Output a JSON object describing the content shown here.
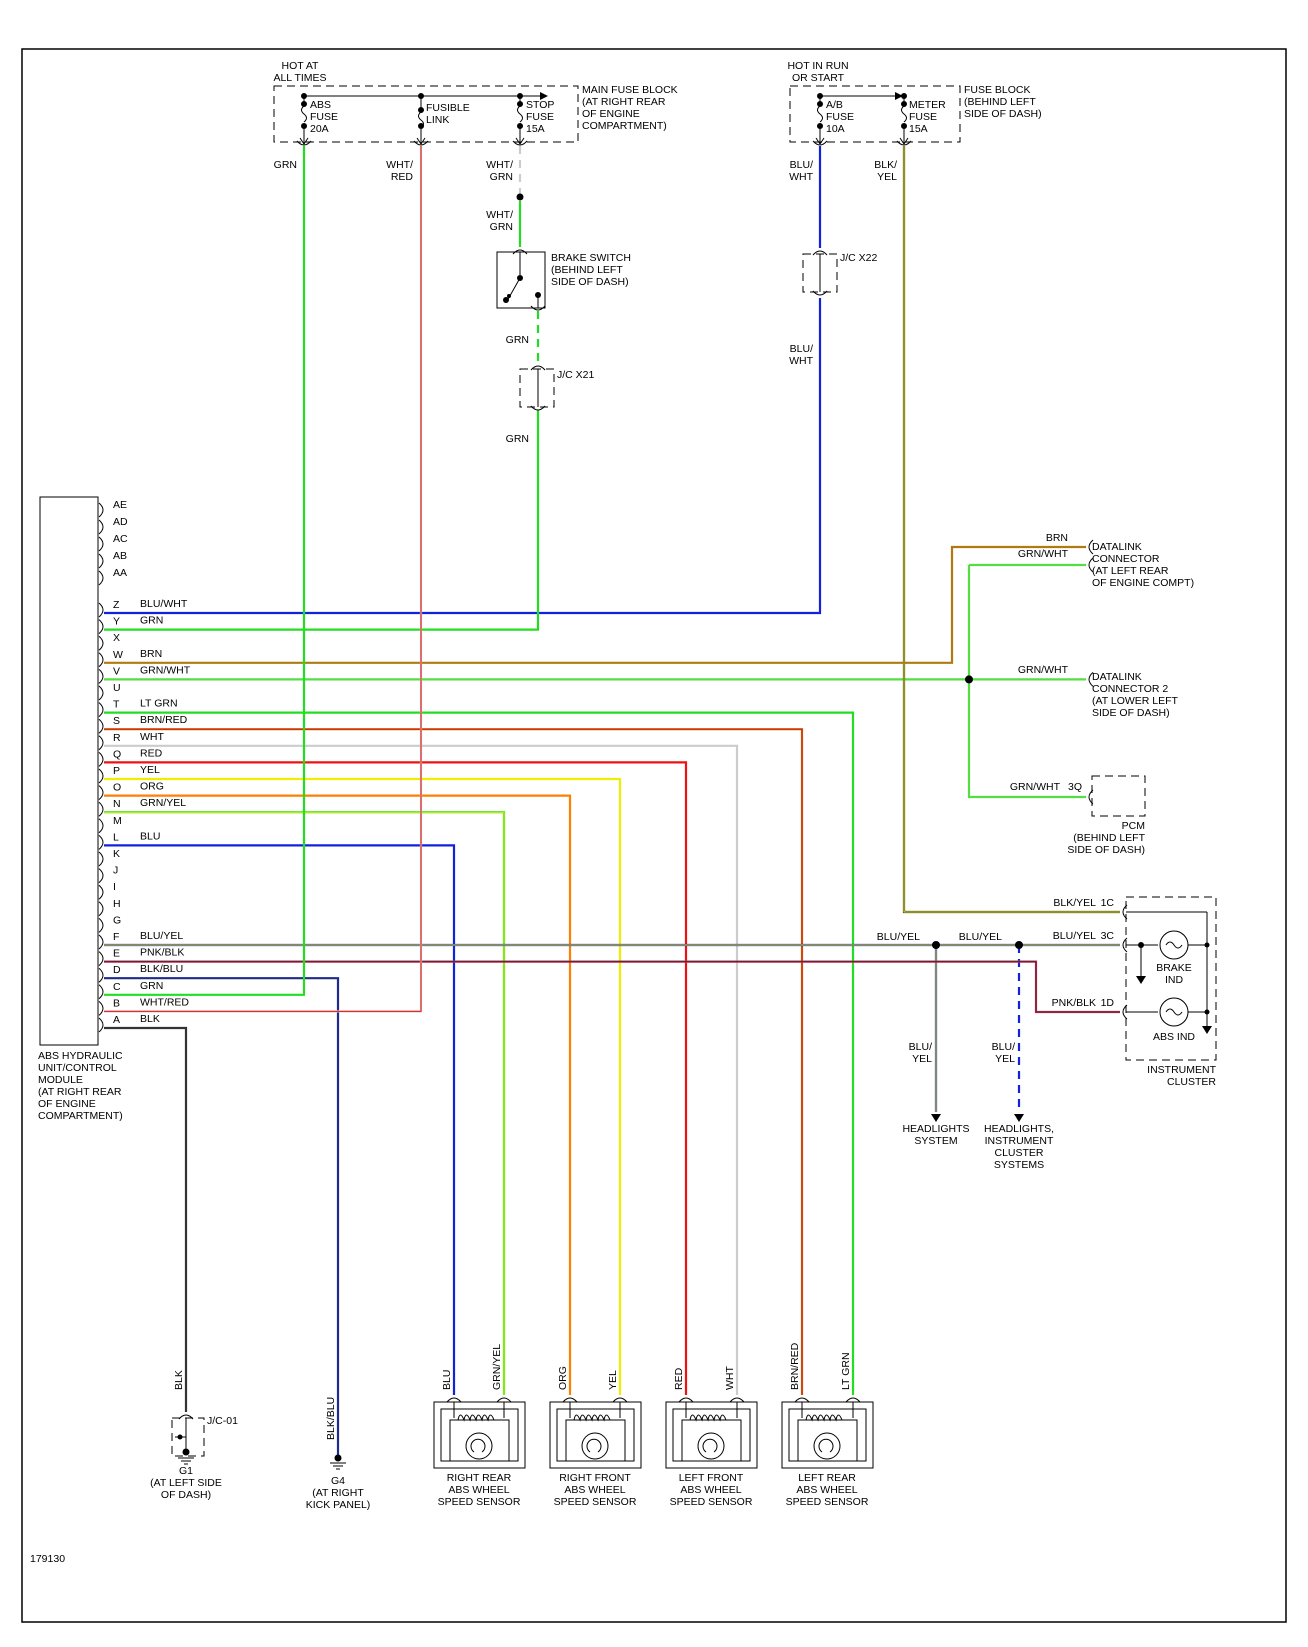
{
  "diagram_id": "179130",
  "colors": {
    "GRN": "#22dd22",
    "LTGRN": "#22dd22",
    "RED": "#ee1111",
    "WHT": "#cccccc",
    "BLU": "#1122dd",
    "YEL": "#eeee00",
    "BRN": "#b07a10",
    "ORG": "#ff7f00",
    "BLK": "#333333",
    "PNK": "#dd2255",
    "GRNWHT": "#55dd44"
  },
  "power": {
    "main_hot_label": [
      "HOT AT",
      "ALL TIMES"
    ],
    "run_hot_label": [
      "HOT IN RUN",
      "OR START"
    ],
    "main_fuse_block": [
      "MAIN FUSE BLOCK",
      "(AT RIGHT REAR",
      "OF ENGINE",
      "COMPARTMENT)"
    ],
    "fuse_block": [
      "FUSE BLOCK",
      "(BEHIND LEFT",
      "SIDE OF DASH)"
    ],
    "fuses": [
      {
        "name": [
          "ABS",
          "FUSE",
          "20A"
        ],
        "wire": [
          "GRN"
        ]
      },
      {
        "name": [
          "FUSIBLE",
          "LINK"
        ],
        "wire": [
          "WHT/",
          "RED"
        ]
      },
      {
        "name": [
          "STOP",
          "FUSE",
          "15A"
        ],
        "wire": [
          "WHT/",
          "GRN"
        ]
      },
      {
        "name": [
          "A/B",
          "FUSE",
          "10A"
        ],
        "wire": [
          "BLU/",
          "WHT"
        ]
      },
      {
        "name": [
          "METER",
          "FUSE",
          "15A"
        ],
        "wire": [
          "BLK/",
          "YEL"
        ]
      }
    ]
  },
  "brake_switch": {
    "label": [
      "BRAKE SWITCH",
      "(BEHIND LEFT",
      "SIDE OF DASH)"
    ],
    "wire_in": [
      "WHT/",
      "GRN"
    ],
    "wire_out": "GRN",
    "jc": "J/C X21",
    "wire_after_jc": "GRN"
  },
  "jc_x22": {
    "label": "J/C X22",
    "wire_after": [
      "BLU/",
      "WHT"
    ]
  },
  "module": {
    "label": [
      "ABS HYDRAULIC",
      "UNIT/CONTROL",
      "MODULE",
      "(AT RIGHT REAR",
      "OF ENGINE",
      "COMPARTMENT)"
    ],
    "pins": [
      {
        "pin": "AE",
        "wire": ""
      },
      {
        "pin": "AD",
        "wire": ""
      },
      {
        "pin": "AC",
        "wire": ""
      },
      {
        "pin": "AB",
        "wire": ""
      },
      {
        "pin": "AA",
        "wire": ""
      },
      {
        "pin": "Z",
        "wire": "BLU/WHT"
      },
      {
        "pin": "Y",
        "wire": "GRN"
      },
      {
        "pin": "X",
        "wire": ""
      },
      {
        "pin": "W",
        "wire": "BRN"
      },
      {
        "pin": "V",
        "wire": "GRN/WHT"
      },
      {
        "pin": "U",
        "wire": ""
      },
      {
        "pin": "T",
        "wire": "LT GRN"
      },
      {
        "pin": "S",
        "wire": "BRN/RED"
      },
      {
        "pin": "R",
        "wire": "WHT"
      },
      {
        "pin": "Q",
        "wire": "RED"
      },
      {
        "pin": "P",
        "wire": "YEL"
      },
      {
        "pin": "O",
        "wire": "ORG"
      },
      {
        "pin": "N",
        "wire": "GRN/YEL"
      },
      {
        "pin": "M",
        "wire": ""
      },
      {
        "pin": "L",
        "wire": "BLU"
      },
      {
        "pin": "K",
        "wire": ""
      },
      {
        "pin": "J",
        "wire": ""
      },
      {
        "pin": "I",
        "wire": ""
      },
      {
        "pin": "H",
        "wire": ""
      },
      {
        "pin": "G",
        "wire": ""
      },
      {
        "pin": "F",
        "wire": "BLU/YEL"
      },
      {
        "pin": "E",
        "wire": "PNK/BLK"
      },
      {
        "pin": "D",
        "wire": "BLK/BLU"
      },
      {
        "pin": "C",
        "wire": "GRN"
      },
      {
        "pin": "B",
        "wire": "WHT/RED"
      },
      {
        "pin": "A",
        "wire": "BLK"
      }
    ]
  },
  "datalink1": {
    "wires": [
      "BRN",
      "GRN/WHT"
    ],
    "label": [
      "DATALINK",
      "CONNECTOR",
      "(AT LEFT REAR",
      "OF ENGINE COMPT)"
    ]
  },
  "datalink2": {
    "wire": "GRN/WHT",
    "label": [
      "DATALINK",
      "CONNECTOR 2",
      "(AT LOWER LEFT",
      "SIDE OF DASH)"
    ]
  },
  "pcm": {
    "wire": "GRN/WHT",
    "pin": "3Q",
    "label": [
      "PCM",
      "(BEHIND LEFT",
      "SIDE OF DASH)"
    ]
  },
  "cluster": {
    "label": [
      "INSTRUMENT",
      "CLUSTER"
    ],
    "pins": [
      {
        "wire": "BLK/YEL",
        "pin": "1C"
      },
      {
        "wire": "BLU/YEL",
        "pin": "3C"
      },
      {
        "wire": "PNK/BLK",
        "pin": "1D"
      }
    ],
    "brake_ind": [
      "BRAKE",
      "IND"
    ],
    "abs_ind": "ABS IND",
    "splice_labels": [
      "BLU/YEL",
      "BLU/YEL"
    ]
  },
  "outputs": [
    {
      "wire": [
        "BLU/",
        "YEL"
      ],
      "label": [
        "HEADLIGHTS",
        "SYSTEM"
      ]
    },
    {
      "wire": [
        "BLU/",
        "YEL"
      ],
      "label": [
        "HEADLIGHTS,",
        "INSTRUMENT",
        "CLUSTER",
        "SYSTEMS"
      ]
    }
  ],
  "grounds": [
    {
      "wire": "BLK",
      "jc": "J/C-01",
      "name": "G1",
      "label": [
        "(AT LEFT SIDE",
        "OF DASH)"
      ]
    },
    {
      "wire": "BLK/BLU",
      "name": "G4",
      "label": [
        "(AT RIGHT",
        "KICK PANEL)"
      ]
    }
  ],
  "sensors": [
    {
      "wires": [
        "BLU",
        "GRN/YEL"
      ],
      "label": [
        "RIGHT REAR",
        "ABS WHEEL",
        "SPEED SENSOR"
      ]
    },
    {
      "wires": [
        "ORG",
        "YEL"
      ],
      "label": [
        "RIGHT FRONT",
        "ABS WHEEL",
        "SPEED SENSOR"
      ]
    },
    {
      "wires": [
        "RED",
        "WHT"
      ],
      "label": [
        "LEFT FRONT",
        "ABS WHEEL",
        "SPEED SENSOR"
      ]
    },
    {
      "wires": [
        "BRN/RED",
        "LT GRN"
      ],
      "label": [
        "LEFT REAR",
        "ABS WHEEL",
        "SPEED SENSOR"
      ]
    }
  ]
}
